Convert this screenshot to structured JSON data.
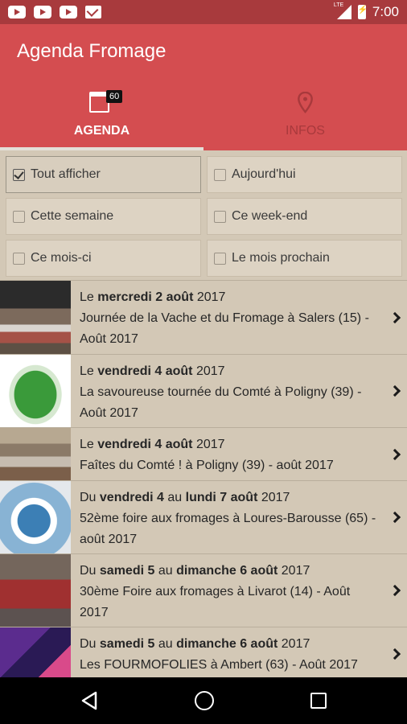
{
  "status_bar": {
    "time": "7:00",
    "notification_icons": [
      "youtube-icon",
      "youtube-icon",
      "youtube-icon",
      "gmail-icon"
    ],
    "network": "LTE"
  },
  "app": {
    "title": "Agenda Fromage",
    "colors": {
      "primary": "#d44d50",
      "status": "#a83a3d",
      "background": "#d3c8b6"
    }
  },
  "tabs": [
    {
      "label": "AGENDA",
      "icon": "calendar-icon",
      "badge": "60",
      "selected": true
    },
    {
      "label": "INFOS",
      "icon": "map-pin-icon",
      "selected": false
    }
  ],
  "filters": [
    {
      "label": "Tout afficher",
      "checked": true
    },
    {
      "label": "Aujourd'hui",
      "checked": false
    },
    {
      "label": "Cette semaine",
      "checked": false
    },
    {
      "label": "Ce week-end",
      "checked": false
    },
    {
      "label": "Ce mois-ci",
      "checked": false
    },
    {
      "label": "Le mois prochain",
      "checked": false
    }
  ],
  "events": [
    {
      "prefix": "Le ",
      "day1": "mercredi 2 août",
      "mid": "",
      "day2": "",
      "year": " 2017",
      "title": "Journée de la Vache et du Fromage à Salers (15) - Août 2017"
    },
    {
      "prefix": "Le ",
      "day1": "vendredi 4 août",
      "mid": "",
      "day2": "",
      "year": " 2017",
      "title": "La savoureuse tournée du Comté à Poligny (39) - Août 2017"
    },
    {
      "prefix": "Le ",
      "day1": "vendredi 4 août",
      "mid": "",
      "day2": "",
      "year": " 2017",
      "title": "Faîtes du Comté ! à Poligny (39) - août 2017"
    },
    {
      "prefix": "Du ",
      "day1": "vendredi 4",
      "mid": " au ",
      "day2": "lundi 7 août",
      "year": " 2017",
      "title": "52ème foire aux fromages à Loures-Barousse (65) - août 2017"
    },
    {
      "prefix": "Du ",
      "day1": "samedi 5",
      "mid": " au ",
      "day2": "dimanche 6 août",
      "year": " 2017",
      "title": "30ème Foire aux fromages à Livarot (14) - Août 2017"
    },
    {
      "prefix": "Du ",
      "day1": "samedi 5",
      "mid": " au ",
      "day2": "dimanche 6 août",
      "year": " 2017",
      "title": "Les FOURMOFOLIES à Ambert (63) - Août 2017"
    }
  ]
}
